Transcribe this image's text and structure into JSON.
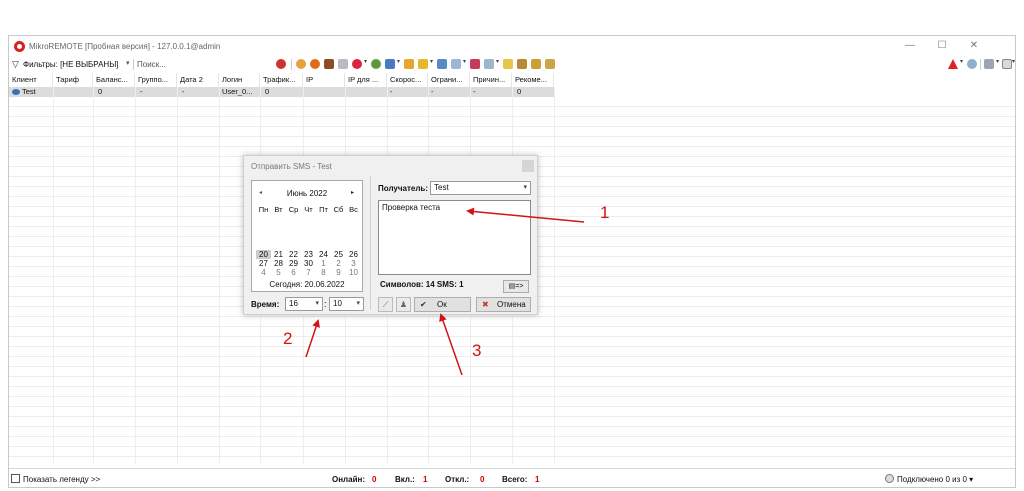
{
  "window": {
    "title": "MikroREMOTE [Пробная версия] - 127.0.0.1@admin",
    "minimize_glyph": "—",
    "maximize_glyph": "☐",
    "close_glyph": "✕"
  },
  "toolbar": {
    "filter_label": "Фильтры: [НЕ ВЫБРАНЫ]",
    "filter_dropdown": "▾",
    "search_label": "Поиск...",
    "icons": [
      "refresh-icon",
      "target-icon",
      "stop-icon",
      "pause-icon",
      "speaker-icon",
      "warning-circle-icon",
      "globe-icon",
      "monitor-icon",
      "window-icon",
      "shape-icon",
      "mail-icon",
      "pencil-icon",
      "card-icon",
      "chart-icon",
      "document-icon",
      "bank-icon",
      "grid-icon",
      "building-icon"
    ],
    "right_icons": [
      "alert-triangle-icon",
      "settings-icon",
      "tools-icon",
      "page-icon"
    ]
  },
  "table": {
    "columns": [
      "Клиент",
      "Тариф",
      "Баланс...",
      "Группо...",
      "Дата 2",
      "Логин",
      "Трафик...",
      "IP",
      "IP для ...",
      "Скорос...",
      "Ограни...",
      "Причин...",
      "Рекоме..."
    ],
    "rows": [
      [
        "Test",
        "",
        "0",
        "-",
        "-",
        "User_0...",
        "0",
        "",
        "",
        "-",
        "-",
        "-",
        "0"
      ]
    ]
  },
  "statusbar": {
    "legend_label": "Показать легенду >>",
    "online_label": "Онлайн:",
    "online_value": "0",
    "on_label": "Вкл.:",
    "on_value": "1",
    "off_label": "Откл.:",
    "off_value": "0",
    "total_label": "Всего:",
    "total_value": "1",
    "connected": "Подключено 0 из 0 ▾"
  },
  "dialog": {
    "title": "Отправить SMS - Test",
    "calendar": {
      "month": "Июнь 2022",
      "prev": "◂",
      "next": "▸",
      "dow": [
        "Пн",
        "Вт",
        "Ср",
        "Чт",
        "Пт",
        "Сб",
        "Вс"
      ],
      "weeks": [
        [
          "20",
          "21",
          "22",
          "23",
          "24",
          "25",
          "26"
        ],
        [
          "27",
          "28",
          "29",
          "30",
          "1",
          "2",
          "3"
        ],
        [
          "4",
          "5",
          "6",
          "7",
          "8",
          "9",
          "10"
        ]
      ],
      "today": "Сегодня: 20.06.2022"
    },
    "time_label": "Время:",
    "hour": "16",
    "colon": ":",
    "minute": "10",
    "recipient_label": "Получатель:",
    "recipient_value": "Test",
    "message": "Проверка теста",
    "chars_label": "Символов: 14   SMS: 1",
    "small_btn": "▤=>",
    "ok_label": "Ок",
    "cancel_label": "Отмена",
    "ok_glyph": "✔",
    "cancel_glyph": "✖"
  },
  "annotations": {
    "label_1": "1",
    "label_2": "2",
    "label_3": "3",
    "color": "#d21414"
  }
}
